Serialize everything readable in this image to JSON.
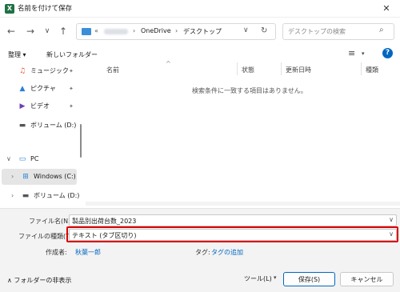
{
  "window": {
    "title": "名前を付けて保存",
    "app_icon_letter": "X",
    "close_glyph": "✕"
  },
  "nav": {
    "back": "←",
    "forward": "→",
    "dropdown": "∨",
    "up": "↑"
  },
  "address": {
    "overflow": "«",
    "separator": "›",
    "segments": [
      "OneDrive",
      "デスクトップ"
    ],
    "dropdown": "∨",
    "refresh": "↻"
  },
  "search": {
    "placeholder": "デスクトップの検索",
    "icon_glyph": "⌕"
  },
  "toolbar": {
    "organize": "整理 ▾",
    "new_folder": "新しいフォルダー",
    "view_glyph": "≡",
    "view_dd": "▾",
    "help_glyph": "?"
  },
  "sidebar": {
    "items": [
      {
        "label": "ミュージック",
        "icon": "music-icon",
        "glyph": "♫",
        "color": "#e8502b",
        "pinned": true
      },
      {
        "label": "ピクチャ",
        "icon": "pictures-icon",
        "glyph": "▲",
        "color": "#2a7fd4",
        "pinned": true
      },
      {
        "label": "ビデオ",
        "icon": "videos-icon",
        "glyph": "▶",
        "color": "#6a3fb5",
        "pinned": true
      },
      {
        "label": "ボリューム (D:)",
        "icon": "drive-icon",
        "glyph": "▬",
        "color": "#555555",
        "pinned": false
      },
      {
        "label": "PC",
        "icon": "pc-icon",
        "glyph": "▭",
        "color": "#2a7fd4",
        "expanded": true
      },
      {
        "label": "Windows (C:)",
        "icon": "windows-drive-icon",
        "glyph": "⊞",
        "color": "#2a7fd4",
        "selected": true
      },
      {
        "label": "ボリューム (D:)",
        "icon": "drive-icon",
        "glyph": "▬",
        "color": "#555555"
      }
    ],
    "pin_glyph": "📌",
    "caret_collapsed": "›",
    "caret_expanded": "∨"
  },
  "filelist": {
    "columns": [
      "名前",
      "状態",
      "更新日時",
      "種類"
    ],
    "sort_indicator": "^",
    "empty_message": "検索条件に一致する項目はありません。"
  },
  "form": {
    "filename_label": "ファイル名(N):",
    "filename_value": "製品別出荷台数_2023",
    "filetype_label": "ファイルの種類(T):",
    "filetype_value": "テキスト (タブ区切り)",
    "dropdown": "∨",
    "author_label": "作成者:",
    "author_value": "秋葉一郎",
    "tags_label": "タグ:",
    "tags_value": "タグの追加"
  },
  "footer": {
    "hide_folders": "フォルダーの非表示",
    "hide_folders_glyph": "∧",
    "tools": "ツール(L)",
    "tools_dd": "▾",
    "save": "保存(S)",
    "cancel": "キャンセル"
  },
  "colors": {
    "highlight_border": "#e00000",
    "accent": "#0067c0",
    "excel_green": "#1f7244"
  }
}
